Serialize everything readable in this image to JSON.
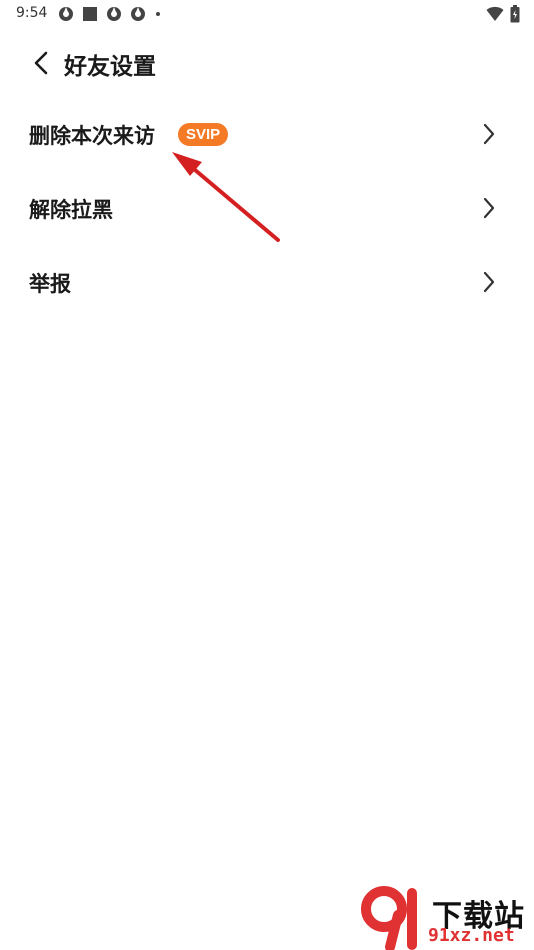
{
  "status_bar": {
    "time": "9:54",
    "left_icons": [
      "app-icon",
      "square-icon",
      "app-icon",
      "app-icon",
      "dot-icon"
    ],
    "right_icons": [
      "wifi-icon",
      "battery-icon"
    ]
  },
  "header": {
    "back_icon": "chevron-left-icon",
    "title": "好友设置"
  },
  "menu": {
    "items": [
      {
        "label": "删除本次来访",
        "badge": "SVIP",
        "chevron_icon": "chevron-right-icon"
      },
      {
        "label": "解除拉黑",
        "chevron_icon": "chevron-right-icon"
      },
      {
        "label": "举报",
        "chevron_icon": "chevron-right-icon"
      }
    ]
  },
  "colors": {
    "badge_bg": "#f47a26",
    "arrow": "#d42020",
    "text": "#1a1a1a"
  },
  "watermark": {
    "logo_icon": "91-logo-icon",
    "text": "下载站",
    "domain": "91xz.net"
  }
}
